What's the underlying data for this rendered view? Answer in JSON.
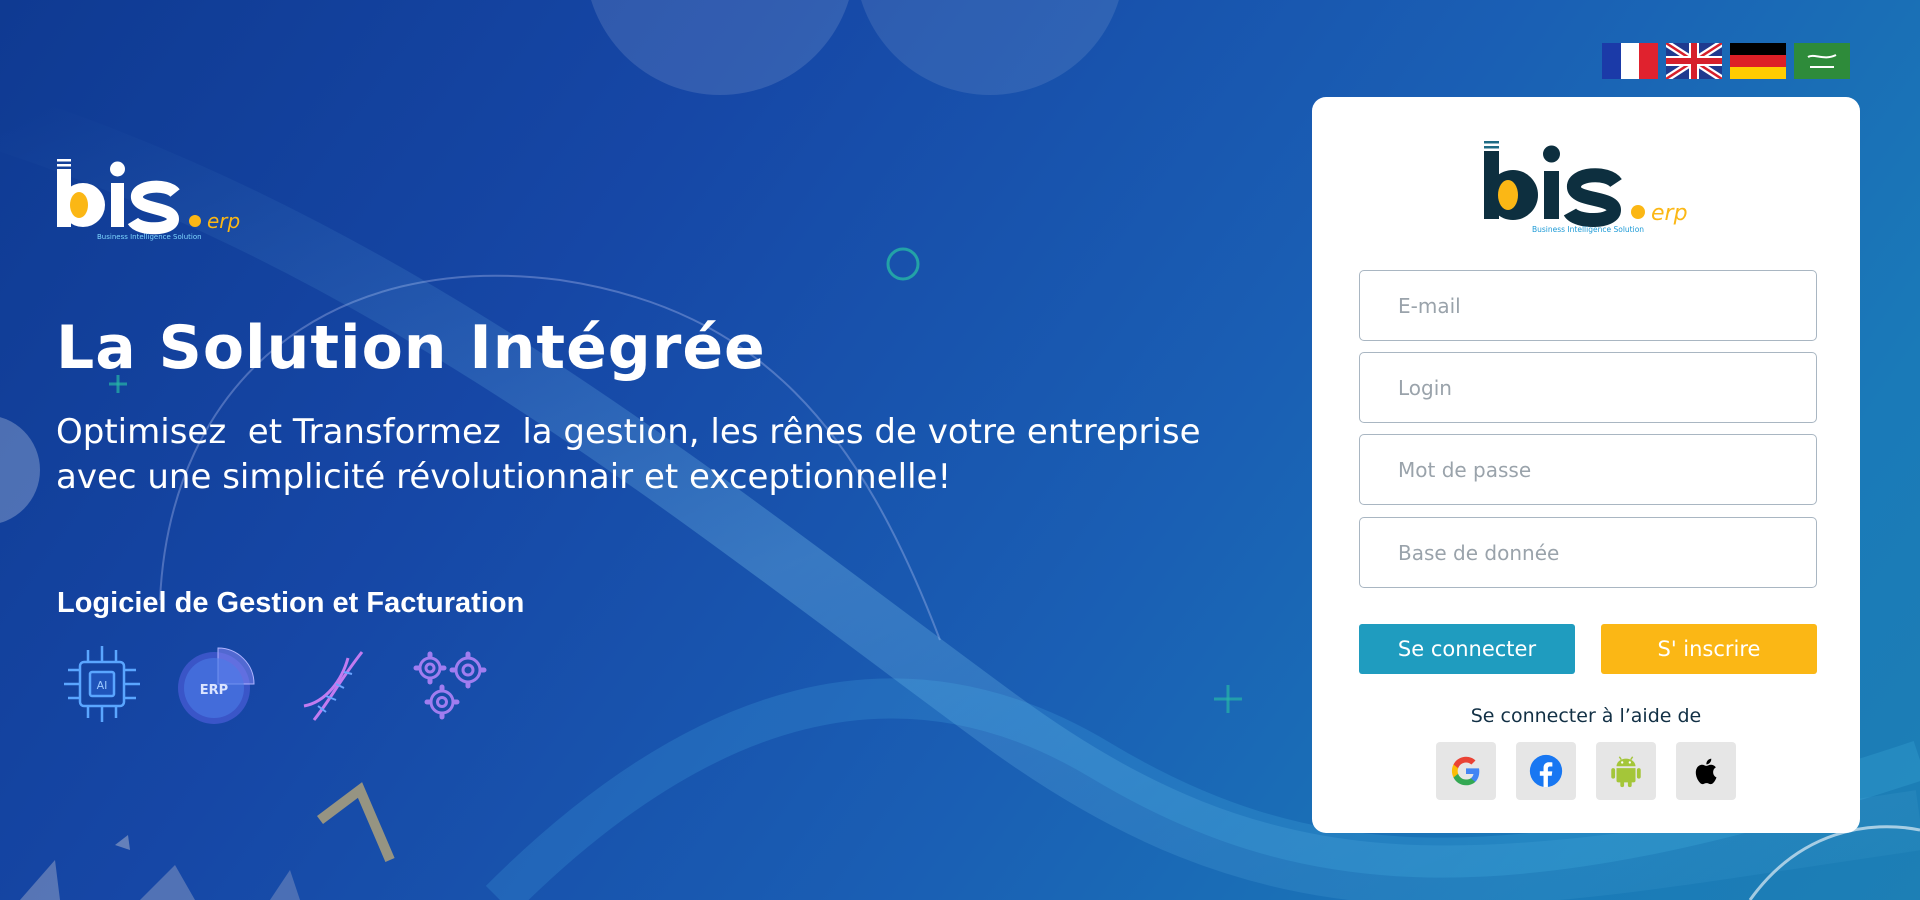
{
  "brand": {
    "logo_text": "bis",
    "logo_suffix": "erp",
    "tagline": "Business Intelligence Solution"
  },
  "hero": {
    "title": "La Solution Intégrée",
    "subtitle": "Optimisez  et Transformez  la gestion, les rênes de votre entreprise\navec une simplicité révolutionnair et exceptionnelle!",
    "caption": "Logiciel de Gestion et Facturation",
    "feature_icons": [
      {
        "name": "ai-chip-icon",
        "label": "AI"
      },
      {
        "name": "erp-icon",
        "label": "ERP"
      },
      {
        "name": "dna-icon",
        "label": ""
      },
      {
        "name": "gears-icon",
        "label": ""
      }
    ]
  },
  "languages": [
    "fr",
    "en",
    "de",
    "ar"
  ],
  "login": {
    "email_placeholder": "E-mail",
    "login_placeholder": "Login",
    "password_placeholder": "Mot de passe",
    "database_placeholder": "Base de donnée",
    "login_button": "Se connecter",
    "register_button": "S' inscrire",
    "social_title": "Se connecter à l’aide de",
    "social_providers": [
      "google-icon",
      "facebook-icon",
      "android-icon",
      "apple-icon"
    ]
  },
  "colors": {
    "accent": "#fbb715",
    "primary": "#1f9cbf",
    "logo_dark": "#0d2f3f",
    "bg_start": "#0f3a92",
    "bg_end": "#1d7fb5"
  }
}
